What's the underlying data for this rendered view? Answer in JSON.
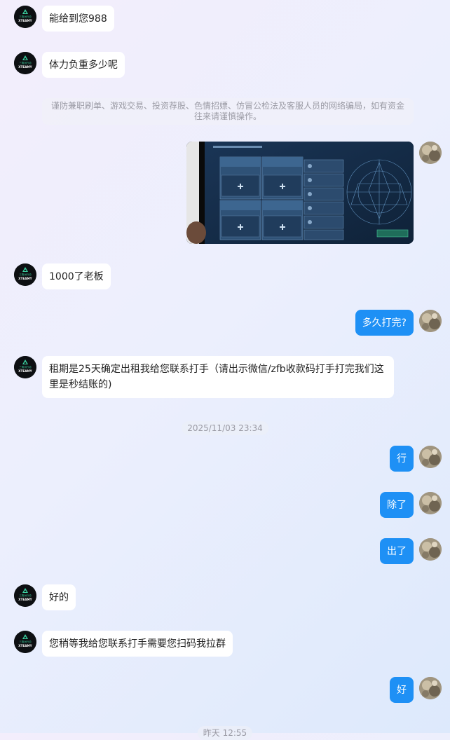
{
  "messages": {
    "m1": "能给到您988",
    "m2": "体力负重多少呢",
    "m3": "1000了老板",
    "m4": "多久打完?",
    "m5": "租期是25天确定出租我给您联系打手（请出示微信/zfb收款码打手打完我们这里是秒结账的)",
    "m6": "行",
    "m7": "除了",
    "m8": "出了",
    "m9": "好的",
    "m10": "您稍等我给您联系打手需要您扫码我拉群",
    "m11": "好"
  },
  "notice": "谨防兼职刷单、游戏交易、投资荐股、色情招嫖、仿冒公检法及客服人员的网络骗局，如有资金往来请谨慎操作。",
  "timestamps": {
    "t1": "2025/11/03 23:34",
    "t2": "昨天 12:55"
  },
  "agent_logo": {
    "line1": "三角洲行动",
    "line2": "XTEAMY"
  },
  "colors": {
    "outgoing_bubble": "#1e90f5",
    "incoming_bubble": "#ffffff",
    "notice_text": "#9a9aa4"
  }
}
